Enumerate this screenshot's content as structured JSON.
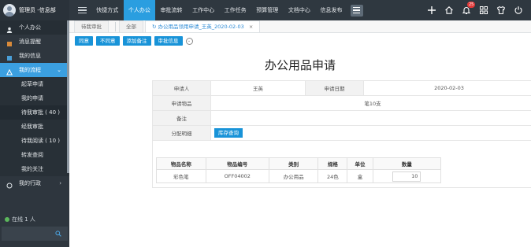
{
  "header": {
    "user_name": "管理员 -信息部",
    "nav": [
      "快捷方式",
      "个人办公",
      "审批流转",
      "工作中心",
      "工作任务",
      "预算管理",
      "文档中心",
      "信息发布"
    ],
    "active_nav_index": 1,
    "notification_count": "25"
  },
  "sidebar": {
    "sections": [
      {
        "label": "个人办公",
        "icon": "person-icon"
      },
      {
        "label": "消息提醒",
        "icon": "bell-icon"
      },
      {
        "label": "我的信息",
        "icon": "info-icon"
      },
      {
        "label": "我的流程",
        "icon": "flow-icon"
      }
    ],
    "sub_items": [
      {
        "label": "起草申请",
        "count": ""
      },
      {
        "label": "我的申请",
        "count": ""
      },
      {
        "label": "待我审批",
        "count": "( 40 )"
      },
      {
        "label": "经我审批",
        "count": ""
      },
      {
        "label": "待我阅读",
        "count": "( 10 )"
      },
      {
        "label": "转发查阅",
        "count": ""
      },
      {
        "label": "我的关注",
        "count": ""
      }
    ],
    "admin_section": "我的行政",
    "online_text": "在线 1 人"
  },
  "tabs": {
    "left_tab": "待我审批",
    "refresh_tab": "全部",
    "active_tab": "办公用品领用申请_王英_2020-02-03",
    "close_symbol": "×"
  },
  "toolbar": {
    "agree": "同意",
    "disagree": "不同意",
    "add_note": "添加备注",
    "audit_info": "审批信息"
  },
  "form": {
    "title": "办公用品申请",
    "applicant_label": "申请人",
    "applicant_value": "王英",
    "date_label": "申请日期",
    "date_value": "2020-02-03",
    "item_label": "申请物品",
    "item_value": "笔10支",
    "note_label": "备注",
    "note_value": "",
    "allocation_label": "分配明细",
    "stock_button": "库存查询"
  },
  "items_table": {
    "headers": [
      "物品名称",
      "物品编号",
      "类别",
      "规格",
      "单位",
      "数量"
    ],
    "rows": [
      [
        "彩色笔",
        "OFF04002",
        "办公用品",
        "24色",
        "盒",
        "10"
      ]
    ]
  },
  "colors": {
    "accent": "#1893d8",
    "sidebar_bg": "#2e363e",
    "topbar_bg": "#2f3840",
    "badge": "#e23a3a"
  }
}
